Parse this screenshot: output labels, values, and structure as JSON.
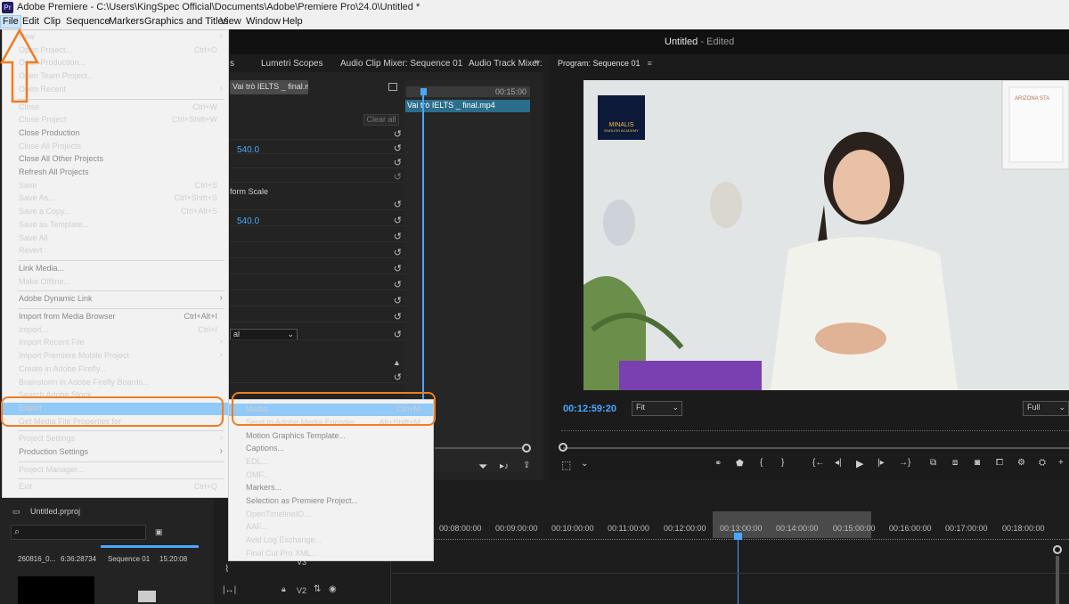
{
  "title_bar": {
    "text": "Adobe Premiere - C:\\Users\\KingSpec Official\\Documents\\Adobe\\Premiere Pro\\24.0\\Untitled *",
    "logo": "Pr"
  },
  "menu_bar": [
    "File",
    "Edit",
    "Clip",
    "Sequence",
    "Markers",
    "Graphics and Titles",
    "View",
    "Window",
    "Help"
  ],
  "header_title": "Untitled",
  "header_status": " - Edited",
  "tabs": [
    "s",
    "Lumetri Scopes",
    "Audio Clip Mixer: Sequence 01",
    "Audio Track Mixer:"
  ],
  "effect_controls": {
    "clip_tab": "Vai trò IELTS _ final.mp4",
    "clear_all": "Clear all",
    "value1": "540.0",
    "label_uniform": "form Scale",
    "value2": "540.0",
    "dropdown": "al"
  },
  "mini_timeline": {
    "time": "00:15:00",
    "clip": "Vai trò IELTS _ final.mp4"
  },
  "program": {
    "tab": "Program: Sequence 01",
    "timecode": "00:12:59:20",
    "fit": "Fit",
    "quality": "Full",
    "logo_text": "MINALIS",
    "logo_sub": "ENGLISH ACADEMY",
    "sign_text": "ARIZONA STA"
  },
  "file_menu": [
    {
      "label": "New",
      "arrow": true
    },
    {
      "label": "Open Project...",
      "shortcut": "Ctrl+O"
    },
    {
      "label": "Open Production..."
    },
    {
      "label": "Open Team Project..."
    },
    {
      "label": "Open Recent",
      "arrow": true
    },
    {
      "sep": true
    },
    {
      "label": "Close",
      "shortcut": "Ctrl+W"
    },
    {
      "label": "Close Project",
      "shortcut": "Ctrl+Shift+W"
    },
    {
      "label": "Close Production",
      "disabled": true
    },
    {
      "label": "Close All Projects"
    },
    {
      "label": "Close All Other Projects",
      "disabled": true
    },
    {
      "label": "Refresh All Projects",
      "disabled": true
    },
    {
      "label": "Save",
      "shortcut": "Ctrl+S"
    },
    {
      "label": "Save As...",
      "shortcut": "Ctrl+Shift+S"
    },
    {
      "label": "Save a Copy...",
      "shortcut": "Ctrl+Alt+S"
    },
    {
      "label": "Save as Template..."
    },
    {
      "label": "Save All"
    },
    {
      "label": "Revert"
    },
    {
      "sep": true
    },
    {
      "label": "Link Media...",
      "disabled": true
    },
    {
      "label": "Make Offline..."
    },
    {
      "sep": true
    },
    {
      "label": "Adobe Dynamic Link",
      "disabled": true,
      "arrow": true
    },
    {
      "sep": true
    },
    {
      "label": "Import from Media Browser",
      "shortcut": "Ctrl+Alt+I",
      "disabled": true
    },
    {
      "label": "Import...",
      "shortcut": "Ctrl+I"
    },
    {
      "label": "Import Recent File",
      "arrow": true
    },
    {
      "label": "Import Premiere Mobile Project",
      "arrow": true
    },
    {
      "label": "Create in Adobe Firefly..."
    },
    {
      "label": "Brainstorm in Adobe Firefly Boards..."
    },
    {
      "label": "Search Adobe Stock..."
    },
    {
      "label": "Export",
      "highlight": true,
      "arrow": true
    },
    {
      "label": "Get Media File Properties for",
      "arrow": true
    },
    {
      "sep": true
    },
    {
      "label": "Project Settings",
      "arrow": true
    },
    {
      "label": "Production Settings",
      "disabled": true,
      "arrow": true
    },
    {
      "sep": true
    },
    {
      "label": "Project Manager..."
    },
    {
      "sep": true
    },
    {
      "label": "Exit",
      "shortcut": "Ctrl+Q"
    }
  ],
  "export_menu": [
    {
      "label": "Media...",
      "shortcut": "Ctrl+M",
      "highlight": true
    },
    {
      "label": "Send to Adobe Media Encoder",
      "shortcut": "Alt+Shift+M"
    },
    {
      "label": "Motion Graphics Template...",
      "disabled": true
    },
    {
      "label": "Captions...",
      "disabled": true
    },
    {
      "label": "EDL..."
    },
    {
      "label": "OMF..."
    },
    {
      "label": "Markers...",
      "disabled": true
    },
    {
      "label": "Selection as Premiere Project...",
      "disabled": true
    },
    {
      "label": "OpenTimelineIO..."
    },
    {
      "label": "AAF..."
    },
    {
      "label": "Avid Log Exchange..."
    },
    {
      "label": "Final Cut Pro XML..."
    }
  ],
  "project_panel": {
    "name": "Untitled.prproj",
    "item1": "260816_0...",
    "item1_dur": "6:36:28734",
    "item2": "Sequence 01",
    "item2_dur": "15:20:08"
  },
  "ruler": [
    "00:08:00:00",
    "00:09:00:00",
    "00:10:00:00",
    "00:11:00:00",
    "00:12:00:00",
    "00:13:00:00",
    "00:14:00:00",
    "00:15:00:00",
    "00:16:00:00",
    "00:17:00:00",
    "00:18:00:00"
  ],
  "tracks": [
    "V3",
    "V2"
  ],
  "colors": {
    "accent": "#4aa6ff",
    "annotation": "#f07d20",
    "menu_highlight": "#91c9f7"
  }
}
